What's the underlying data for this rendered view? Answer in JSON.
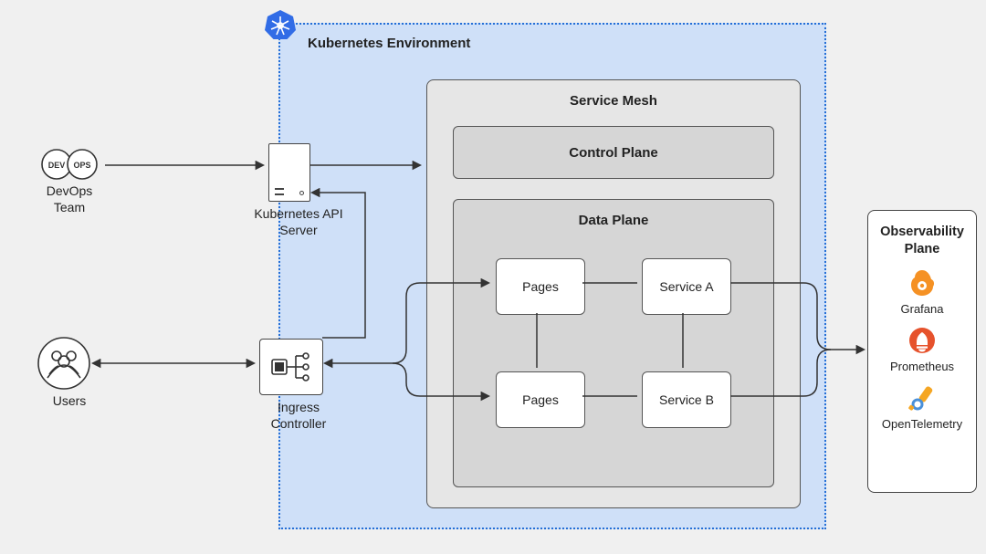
{
  "external": {
    "devops_label": "DevOps Team",
    "devops_left": "DEV",
    "devops_right": "OPS",
    "users_label": "Users"
  },
  "k8s": {
    "title": "Kubernetes Environment",
    "api_server_label": "Kubernetes API Server",
    "ingress_label": "Ingress Controller"
  },
  "service_mesh": {
    "title": "Service Mesh",
    "control_plane": "Control Plane",
    "data_plane": {
      "title": "Data Plane",
      "services": {
        "pages1": "Pages",
        "service_a": "Service A",
        "pages2": "Pages",
        "service_b": "Service B"
      }
    }
  },
  "observability": {
    "title": "Observability Plane",
    "items": {
      "grafana": "Grafana",
      "prometheus": "Prometheus",
      "opentelemetry": "OpenTelemetry"
    }
  }
}
